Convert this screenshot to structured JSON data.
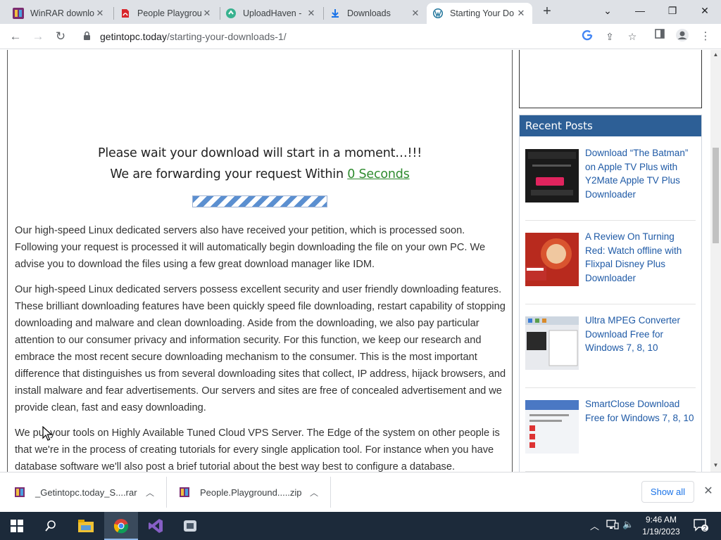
{
  "browser": {
    "tabs": [
      {
        "label": "WinRAR download",
        "icon": "winrar-icon"
      },
      {
        "label": "People Playground",
        "icon": "pdf-icon"
      },
      {
        "label": "UploadHaven -",
        "icon": "uploadhaven-icon"
      },
      {
        "label": "Downloads",
        "icon": "download-icon"
      },
      {
        "label": "Starting Your Do",
        "icon": "wordpress-icon",
        "active": true
      }
    ],
    "url_domain": "getintopc.today",
    "url_path": "/starting-your-downloads-1/"
  },
  "page": {
    "wait_line1": "Please wait your download will start in a moment…!!!",
    "wait_line2_prefix": "We are forwarding your request Within ",
    "wait_line2_link": "0 Seconds",
    "progress_fraction": 1.0,
    "para1": "Our high-speed Linux dedicated servers also have received your petition, which is processed soon. Following your request is processed it will automatically begin downloading the file on your own PC. We advise you to download the files using a few great download manager like IDM.",
    "para2": "Our high-speed Linux dedicated servers possess excellent security and user friendly downloading features. These brilliant downloading features have been quickly speed file downloading, restart capability of stopping downloading and malware and clean downloading. Aside from the downloading, we also pay particular attention to our consumer privacy and information security. For this function, we keep our research and embrace the most recent secure downloading mechanism to the consumer. This is the most important difference that distinguishes us from several downloading sites that collect, IP address, hijack browsers, and install malware and fear advertisements. Our servers and sites are free of concealed advertisement and we provide clean, fast and easy downloading.",
    "para3": "We put your tools on Highly Available Tuned Cloud VPS Server. The Edge of the system on other people is that we're in the process of creating tutorials for every single application tool. For instance when you have database software we'll also post a brief tutorial about the best way best to configure a database."
  },
  "sidebar": {
    "recent_posts_heading": "Recent Posts",
    "posts": [
      {
        "title": "Download “The Batman” on Apple TV Plus with Y2Mate Apple TV Plus Downloader"
      },
      {
        "title": "A Review On Turning Red: Watch offline with Flixpal Disney Plus Downloader"
      },
      {
        "title": "Ultra MPEG Converter Download Free for Windows 7, 8, 10"
      },
      {
        "title": "SmartClose Download Free for Windows 7, 8, 10"
      }
    ]
  },
  "downloads": {
    "items": [
      {
        "name": "_Getintopc.today_S....rar"
      },
      {
        "name": "People.Playground.....zip"
      }
    ],
    "show_all": "Show all"
  },
  "taskbar": {
    "time": "9:46 AM",
    "date": "1/19/2023"
  }
}
